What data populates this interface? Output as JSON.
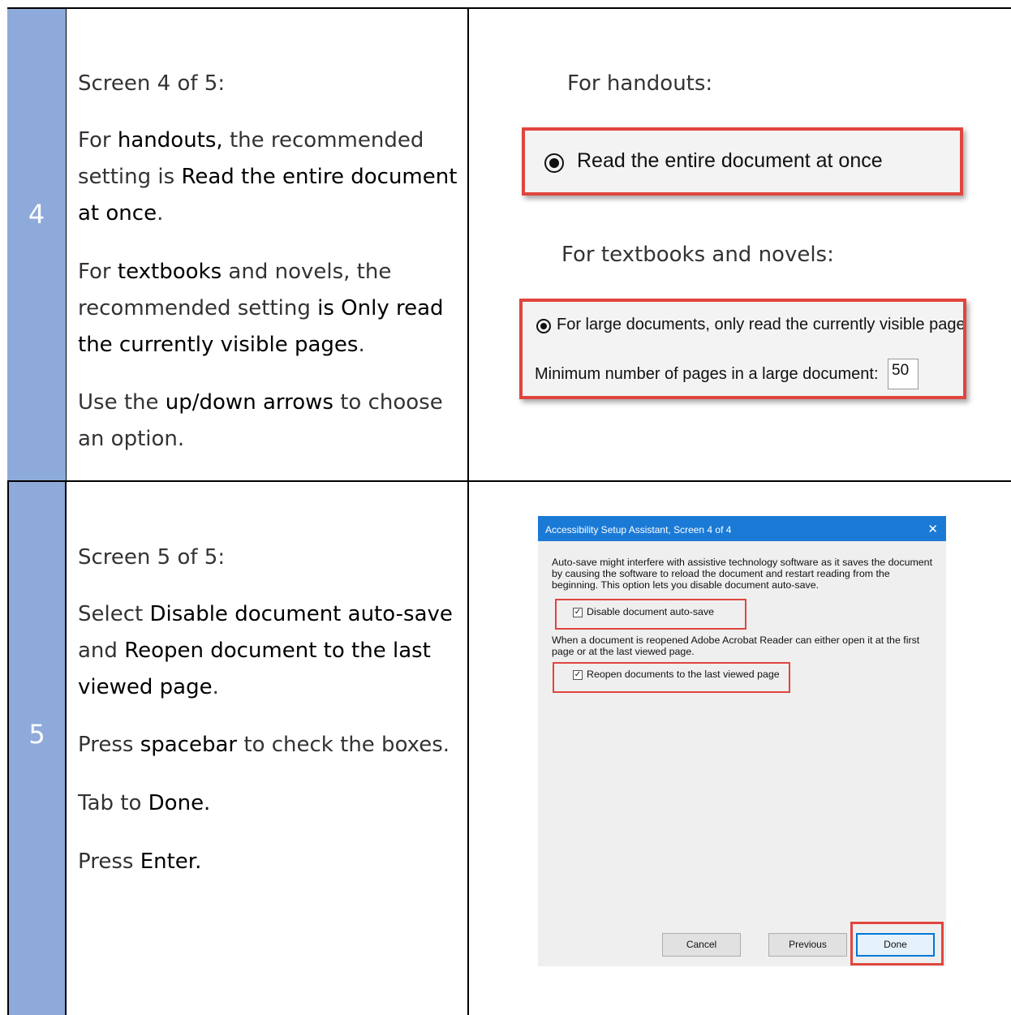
{
  "row4": {
    "step": "4",
    "left": {
      "p1": "Screen 4 of 5:",
      "p2_a": "For ",
      "p2_b": "handouts,",
      "p2_c": " the recommended setting is ",
      "p2_d": "Read the entire document at once",
      "p2_e": ".",
      "p3_a": "For ",
      "p3_b": "textbooks",
      "p3_c": " and novels, the recommended setting ",
      "p3_d": "is Only read the currently visible pages",
      "p3_e": ".",
      "p4_a": "Use the ",
      "p4_b": "up/down arrows",
      "p4_c": " to choose an option."
    },
    "right": {
      "caption1": "For handouts:",
      "option1": "Read the entire document at once",
      "caption2": "For textbooks and novels:",
      "option2": "For large documents, only read the currently visible pages",
      "min_pages_label": "Minimum number of pages in a large document:",
      "min_pages_value": "50"
    }
  },
  "row5": {
    "step": "5",
    "left": {
      "p1": "Screen 5 of 5:",
      "p2_a": "Select ",
      "p2_b": "Disable document auto-save",
      "p2_c": " and ",
      "p2_d": "Reopen document to the last viewed page",
      "p2_e": ".",
      "p3_a": "Press ",
      "p3_b": "spacebar",
      "p3_c": " to check the boxes.",
      "p4_a": "Tab to ",
      "p4_b": "Done.",
      "p5_a": "Press ",
      "p5_b": "Enter."
    },
    "dialog": {
      "title": "Accessibility Setup Assistant, Screen 4 of 4",
      "close": "✕",
      "text1": "Auto-save might interfere with assistive technology software as it saves the document by causing the software to reload the document and restart reading from the beginning. This option lets you disable document auto-save.",
      "check1": "Disable document auto-save",
      "check1_checked": true,
      "text2": "When a document is reopened Adobe Acrobat Reader can either open it at the first page or at the last viewed page.",
      "check2": "Reopen documents to the last viewed page",
      "check2_checked": true,
      "buttons": {
        "cancel": "Cancel",
        "previous": "Previous",
        "done": "Done"
      }
    }
  },
  "colors": {
    "step_column": "#8eaadb",
    "highlight": "#e0453e",
    "dialog_title": "#1a7ad6"
  }
}
